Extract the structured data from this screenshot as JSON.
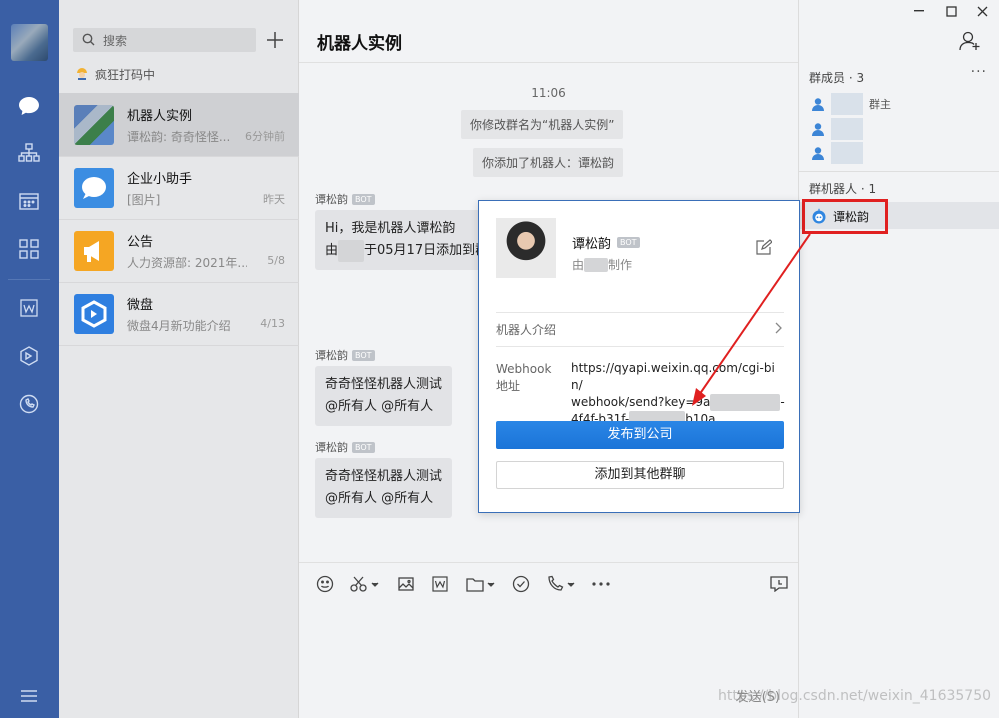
{
  "nav": {
    "items": [
      {
        "name": "messages",
        "icon": "chat-bubble-icon"
      },
      {
        "name": "contacts",
        "icon": "org-chart-icon"
      },
      {
        "name": "calendar",
        "icon": "calendar-icon"
      },
      {
        "name": "workbench",
        "icon": "grid-icon"
      },
      {
        "name": "docs",
        "icon": "word-doc-icon"
      },
      {
        "name": "weipan",
        "icon": "cube-icon"
      },
      {
        "name": "phone",
        "icon": "phone-icon"
      },
      {
        "name": "menu",
        "icon": "hamburger-icon"
      }
    ]
  },
  "search": {
    "placeholder": "搜索"
  },
  "status": {
    "text": "疯狂打码中"
  },
  "sessions": [
    {
      "name": "机器人实例",
      "preview": "谭松韵: 奇奇怪怪...",
      "time": "6分钟前",
      "active": true
    },
    {
      "name": "企业小助手",
      "preview": "[图片]",
      "time": "昨天",
      "active": false
    },
    {
      "name": "公告",
      "preview": "人力资源部: 2021年...",
      "time": "5/8",
      "active": false
    },
    {
      "name": "微盘",
      "preview": "微盘4月新功能介绍",
      "time": "4/13",
      "active": false
    }
  ],
  "chat": {
    "title": "机器人实例",
    "timestamp": "11:06",
    "system_msgs": [
      "你修改群名为“机器人实例”",
      "你添加了机器人：谭松韵"
    ],
    "messages": [
      {
        "sender": "谭松韵",
        "tag": "BOT",
        "line1": "Hi，我是机器人谭松韵",
        "line2_pre": "由",
        "line2_post": "于05月17日添加到群"
      },
      {
        "sender": "谭松韵",
        "tag": "BOT",
        "line1": "奇奇怪怪机器人测试",
        "line2": "@所有人  @所有人"
      },
      {
        "sender": "谭松韵",
        "tag": "BOT",
        "line1": "奇奇怪怪机器人测试",
        "line2": "@所有人  @所有人"
      }
    ],
    "send_label": "发送(S)"
  },
  "group": {
    "members_header": "群成员 · 3",
    "owner_label": "群主",
    "robots_header": "群机器人 · 1",
    "robot_name": "谭松韵"
  },
  "card": {
    "robot_name": "谭松韵",
    "tag": "BOT",
    "maker_pre": "由",
    "maker_post": "制作",
    "intro_label": "机器人介绍",
    "webhook_label_1": "Webhook",
    "webhook_label_2": "地址",
    "webhook_line1": "https://qyapi.weixin.qq.com/cgi-bin/",
    "webhook_line2_pre": "webhook/send?key=9a",
    "webhook_line2_post": "-",
    "webhook_line3_pre": "4f4f-b31f-",
    "webhook_line3_post": "b10a",
    "publish_button": "发布到公司",
    "add_button": "添加到其他群聊"
  },
  "watermark": "https://blog.csdn.net/weixin_41635750",
  "colors": {
    "rail": "#3a5fa5",
    "primary": "#1b74d8",
    "annotation": "#e02020"
  }
}
